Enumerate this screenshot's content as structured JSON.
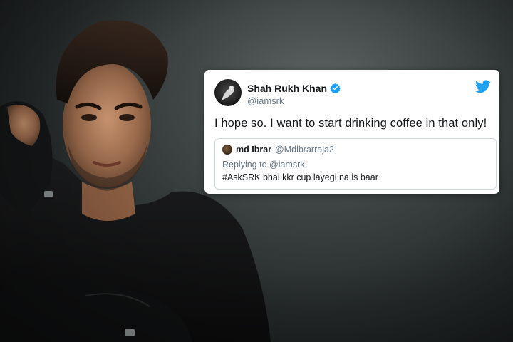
{
  "tweet": {
    "author_name": "Shah Rukh Khan",
    "author_handle": "@iamsrk",
    "verified": true,
    "text": "I hope so. I want to start drinking coffee in that only!",
    "brand_color": "#1da1f2",
    "quoted": {
      "author_name": "md Ibrar",
      "author_handle": "@Mdibrarraja2",
      "replying_to": "Replying to @iamsrk",
      "text": "#AskSRK bhai kkr cup layegi na is baar"
    }
  },
  "icons": {
    "twitter_logo": "twitter-bird-icon",
    "verified_badge": "verified-badge-icon"
  }
}
